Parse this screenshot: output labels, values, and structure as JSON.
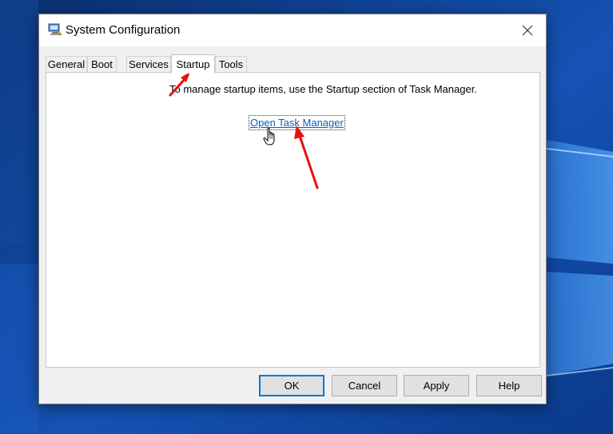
{
  "window": {
    "title": "System Configuration",
    "icon": "msconfig-icon",
    "close_glyph": "✕"
  },
  "tabs": [
    {
      "label": "General",
      "selected": false
    },
    {
      "label": "Boot",
      "selected": false
    },
    {
      "label": "Services",
      "selected": false
    },
    {
      "label": "Startup",
      "selected": true
    },
    {
      "label": "Tools",
      "selected": false
    }
  ],
  "startup_panel": {
    "info_text": "To manage startup items, use the Startup section of Task Manager.",
    "link_text": "Open Task Manager"
  },
  "buttons": {
    "ok": "OK",
    "cancel": "Cancel",
    "apply": "Apply",
    "help": "Help"
  },
  "colors": {
    "annotation_arrow": "#e81010",
    "link": "#0b5fbd",
    "desktop": "#0c3f8c"
  }
}
